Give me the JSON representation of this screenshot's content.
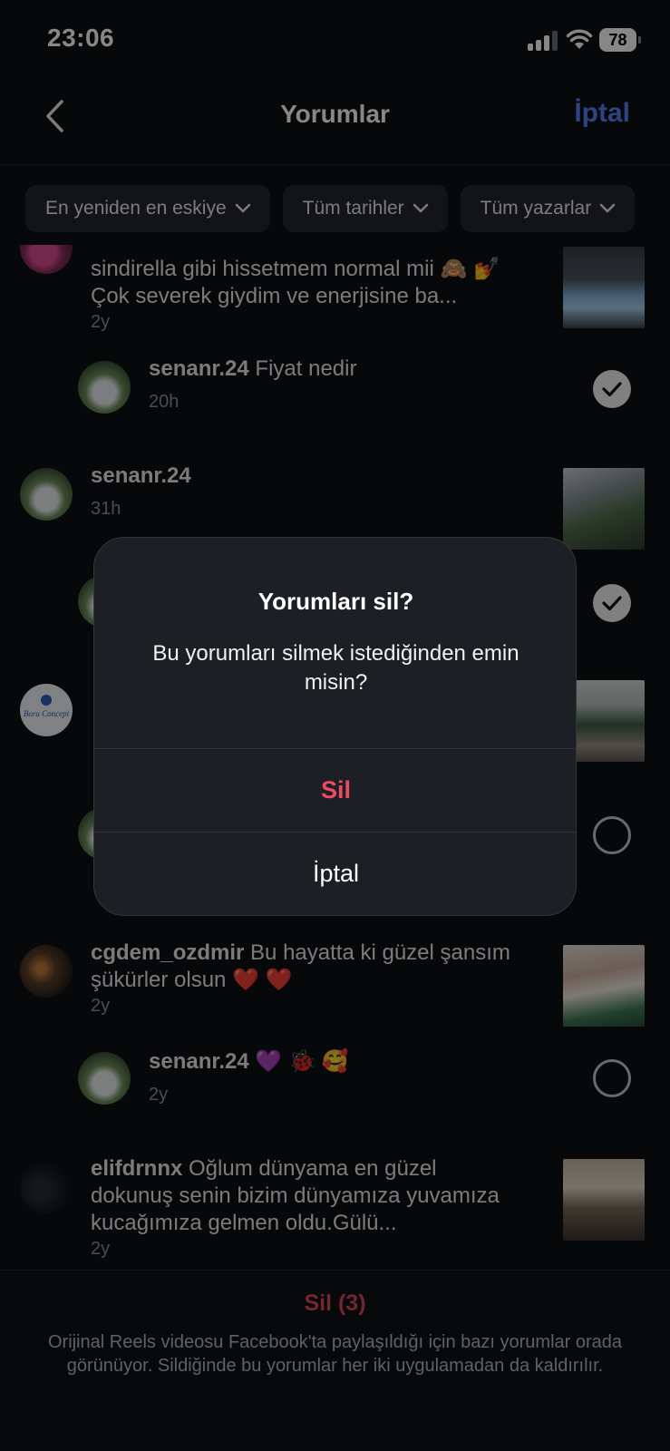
{
  "status": {
    "time": "23:06",
    "battery": "78"
  },
  "nav": {
    "title": "Yorumlar",
    "cancel": "İptal"
  },
  "filters": [
    "En yeniden en eskiye",
    "Tüm tarihler",
    "Tüm yazarlar"
  ],
  "comments": [
    {
      "text": "sindirella gibi hissetmem normal mii 🙈 💅 Çok severek giydim ve enerjisine ba...",
      "time": "2y"
    },
    {
      "user": "senanr.24",
      "text": "Fiyat nedir",
      "time": "20h",
      "checked": true
    },
    {
      "user": "senanr.24",
      "text": "",
      "time": "31h"
    },
    {
      "checked": true
    },
    {
      "logo_text": "Bora Concept"
    },
    {
      "checked": false
    },
    {
      "user": "cgdem_ozdmir",
      "text": "Bu hayatta ki  güzel şansım şükürler olsun ❤️ ❤️",
      "time": "2y"
    },
    {
      "user": "senanr.24",
      "text": "💜 🐞 🥰",
      "time": "2y",
      "checked": false
    },
    {
      "user": "elifdrnnx",
      "text": "Oğlum dünyama en güzel dokunuş senin bizim dünyamıza yuvamıza kucağımıza gelmen oldu.Gülü...",
      "time": "2y"
    }
  ],
  "dialog": {
    "title": "Yorumları sil?",
    "message": "Bu yorumları silmek istediğinden emin misin?",
    "delete_label": "Sil",
    "cancel_label": "İptal"
  },
  "footer": {
    "delete_label": "Sil (3)",
    "note": "Orijinal Reels videosu Facebook'ta paylaşıldığı için bazı yorumlar orada görünüyor. Sildiğinde bu yorumlar her iki uygulamadan da kaldırılır."
  },
  "colors": {
    "accent": "#5a7ff5",
    "destructive": "#ed4a63",
    "background": "#0d1013"
  }
}
